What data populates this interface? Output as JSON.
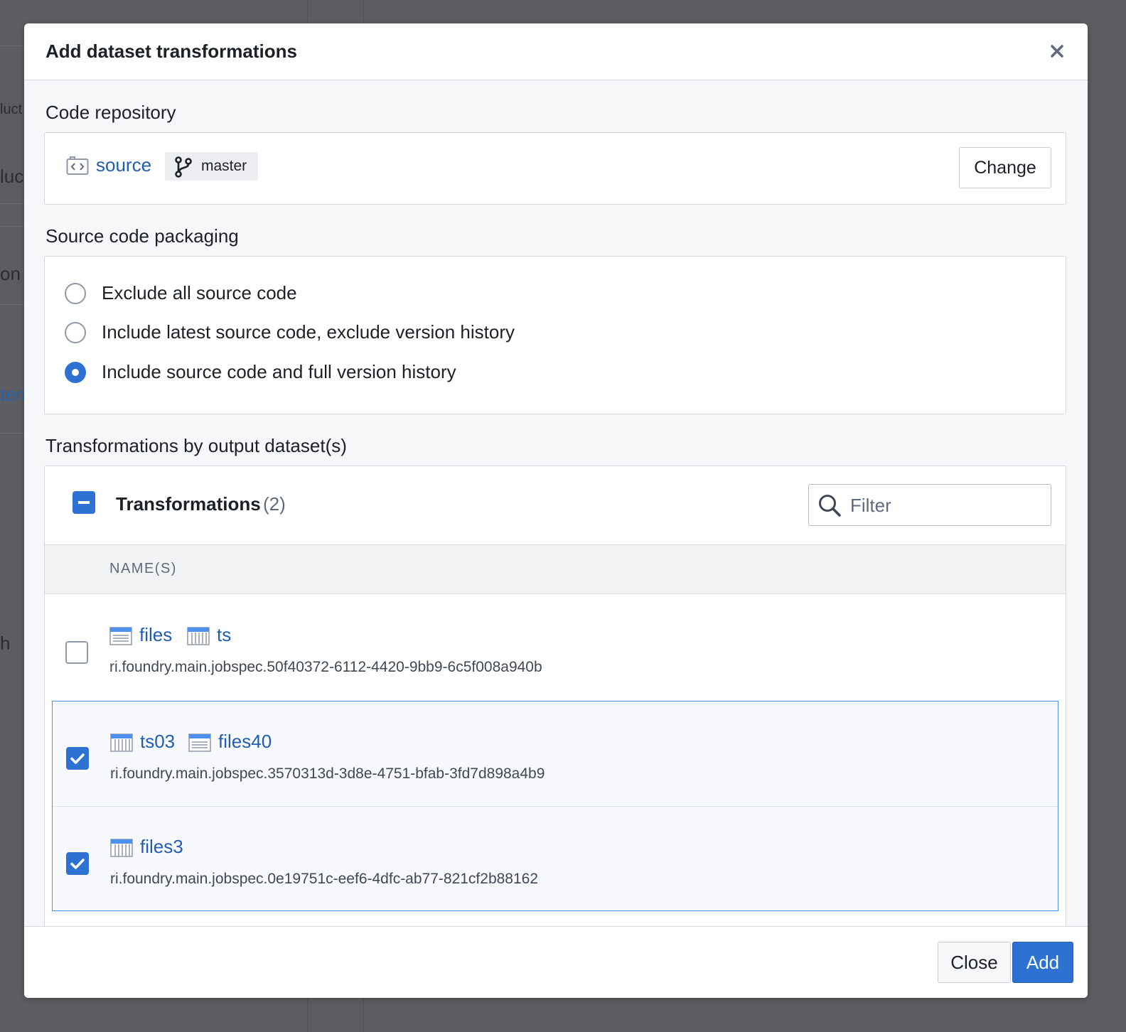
{
  "background": {
    "fragments": [
      "luct",
      "luc",
      "on",
      "ten",
      "h"
    ]
  },
  "dialog": {
    "title": "Add dataset transformations",
    "close_icon": "close-icon"
  },
  "code_repository": {
    "label": "Code repository",
    "repo_icon": "code-repository-icon",
    "repo_name": "source",
    "branch_icon": "git-branch-icon",
    "branch": "master",
    "change_label": "Change"
  },
  "packaging": {
    "label": "Source code packaging",
    "options": [
      {
        "label": "Exclude all source code",
        "selected": false
      },
      {
        "label": "Include latest source code, exclude version history",
        "selected": false
      },
      {
        "label": "Include source code and full version history",
        "selected": true
      }
    ]
  },
  "transformations": {
    "label": "Transformations by output dataset(s)",
    "header_title": "Transformations",
    "count": "(2)",
    "select_all_state": "indeterminate",
    "filter_placeholder": "Filter",
    "column_header": "NAME(S)",
    "rows": [
      {
        "checked": false,
        "datasets": [
          {
            "name": "files",
            "icon": "table-icon"
          },
          {
            "name": "ts",
            "icon": "columns-table-icon"
          }
        ],
        "rid": "ri.foundry.main.jobspec.50f40372-6112-4420-9bb9-6c5f008a940b"
      },
      {
        "checked": true,
        "datasets": [
          {
            "name": "ts03",
            "icon": "columns-table-icon"
          },
          {
            "name": "files40",
            "icon": "table-icon"
          }
        ],
        "rid": "ri.foundry.main.jobspec.3570313d-3d8e-4751-bfab-3fd7d898a4b9"
      },
      {
        "checked": true,
        "datasets": [
          {
            "name": "files3",
            "icon": "columns-table-icon"
          }
        ],
        "rid": "ri.foundry.main.jobspec.0e19751c-eef6-4dfc-ab77-821cf2b88162"
      }
    ]
  },
  "footer": {
    "close_label": "Close",
    "add_label": "Add"
  },
  "colors": {
    "accent": "#2d72d2",
    "link": "#215db0",
    "overlay": "#5b5d61",
    "selection_border": "#4c90f0"
  }
}
